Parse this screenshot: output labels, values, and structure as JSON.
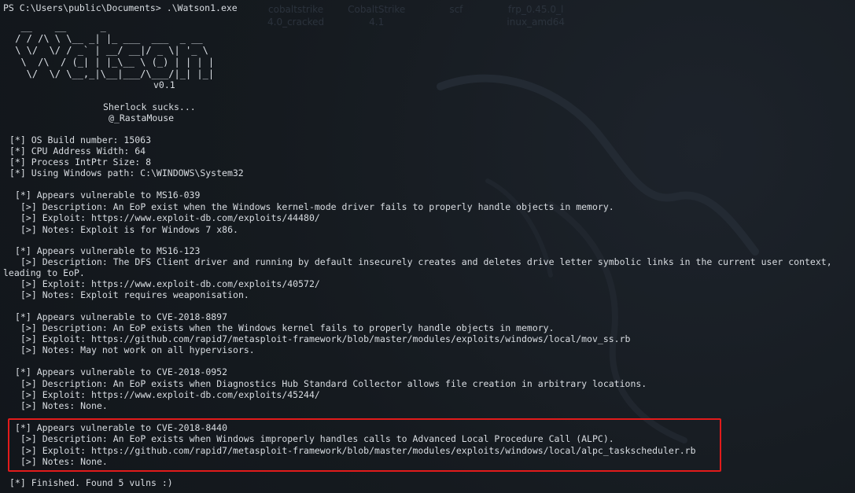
{
  "desktop_icons": [
    {
      "label": "cobaltstrike\n4.0_cracked"
    },
    {
      "label": "CobaltStrike\n4.1"
    },
    {
      "label": "scf"
    },
    {
      "label": "frp_0.45.0_l\ninux_amd64"
    }
  ],
  "prompt": "PS C:\\Users\\public\\Documents> .\\Watson1.exe",
  "banner_ascii": "  __    __      _\n / / /\\ \\ \\__ _| |_ ___  ___  _ __\n \\ \\/  \\/ / _` | __/ __|/ _ \\| '_ \\\n  \\  /\\  / (_| | |_\\__ \\ (_) | | | |\n   \\/  \\/ \\__,_|\\__|___/\\___/|_| |_|",
  "version": "v0.1",
  "tagline": "Sherlock sucks...",
  "author": "@_RastaMouse",
  "system_info": [
    "[*] OS Build number: 15063",
    "[*] CPU Address Width: 64",
    "[*] Process IntPtr Size: 8",
    "[*] Using Windows path: C:\\WINDOWS\\System32"
  ],
  "vulns": [
    {
      "header": "[*] Appears vulnerable to MS16-039",
      "lines": [
        "[>] Description: An EoP exist when the Windows kernel-mode driver fails to properly handle objects in memory.",
        "[>] Exploit: https://www.exploit-db.com/exploits/44480/",
        "[>] Notes: Exploit is for Windows 7 x86."
      ]
    },
    {
      "header": "[*] Appears vulnerable to MS16-123",
      "lines": [
        "[>] Description: The DFS Client driver and running by default insecurely creates and deletes drive letter symbolic links in the current user context,",
        "leading to EoP.",
        "[>] Exploit: https://www.exploit-db.com/exploits/40572/",
        "[>] Notes: Exploit requires weaponisation."
      ]
    },
    {
      "header": "[*] Appears vulnerable to CVE-2018-8897",
      "lines": [
        "[>] Description: An EoP exists when the Windows kernel fails to properly handle objects in memory.",
        "[>] Exploit: https://github.com/rapid7/metasploit-framework/blob/master/modules/exploits/windows/local/mov_ss.rb",
        "[>] Notes: May not work on all hypervisors."
      ]
    },
    {
      "header": "[*] Appears vulnerable to CVE-2018-0952",
      "lines": [
        "[>] Description: An EoP exists when Diagnostics Hub Standard Collector allows file creation in arbitrary locations.",
        "[>] Exploit: https://www.exploit-db.com/exploits/45244/",
        "[>] Notes: None."
      ]
    },
    {
      "header": "[*] Appears vulnerable to CVE-2018-8440",
      "lines": [
        "[>] Description: An EoP exists when Windows improperly handles calls to Advanced Local Procedure Call (ALPC).",
        "[>] Exploit: https://github.com/rapid7/metasploit-framework/blob/master/modules/exploits/windows/local/alpc_taskscheduler.rb",
        "[>] Notes: None."
      ]
    }
  ],
  "finished": "[*] Finished. Found 5 vulns :)",
  "colors": {
    "background": "#151a1f",
    "text": "#d9dde2",
    "highlight_border": "#e21b1b"
  }
}
